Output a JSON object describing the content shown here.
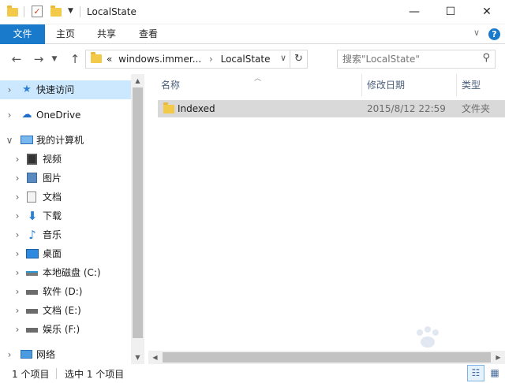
{
  "window": {
    "title": "LocalState",
    "minimize": "—",
    "maximize": "☐",
    "close": "✕"
  },
  "ribbon": {
    "tabs": [
      "文件",
      "主页",
      "共享",
      "查看"
    ],
    "expand": "∨",
    "help": "?"
  },
  "address": {
    "overflow": "«",
    "crumbs": [
      "windows.immer...",
      "LocalState"
    ],
    "crumb_separator": "›"
  },
  "search": {
    "placeholder": "搜索\"LocalState\""
  },
  "nav_pane": {
    "items": [
      {
        "label": "快速访问",
        "icon": "star-icon"
      },
      {
        "label": "OneDrive",
        "icon": "cloud-icon"
      },
      {
        "label": "我的计算机",
        "icon": "computer-icon"
      },
      {
        "label": "视频",
        "icon": "video-icon"
      },
      {
        "label": "图片",
        "icon": "picture-icon"
      },
      {
        "label": "文档",
        "icon": "document-icon"
      },
      {
        "label": "下载",
        "icon": "download-icon"
      },
      {
        "label": "音乐",
        "icon": "music-icon"
      },
      {
        "label": "桌面",
        "icon": "desktop-icon"
      },
      {
        "label": "本地磁盘 (C:)",
        "icon": "drive-icon"
      },
      {
        "label": "软件 (D:)",
        "icon": "drive-icon"
      },
      {
        "label": "文档 (E:)",
        "icon": "drive-icon"
      },
      {
        "label": "娱乐 (F:)",
        "icon": "drive-icon"
      },
      {
        "label": "网络",
        "icon": "network-icon"
      }
    ]
  },
  "columns": {
    "name": "名称",
    "modified": "修改日期",
    "type": "类型"
  },
  "files": [
    {
      "name": "Indexed",
      "modified": "2015/8/12 22:59",
      "type": "文件夹"
    }
  ],
  "status": {
    "count": "1 个项目",
    "selected": "选中 1 个项目"
  },
  "colors": {
    "accent": "#1979ca",
    "selection": "#cce8ff",
    "folder": "#f3c94a"
  }
}
